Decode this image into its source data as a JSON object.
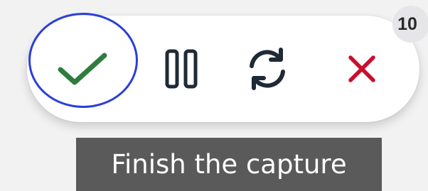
{
  "toolbar": {
    "finish_icon": "checkmark-icon",
    "pause_icon": "pause-icon",
    "restart_icon": "refresh-icon",
    "cancel_icon": "close-icon",
    "finish_color": "#2e7d3e",
    "control_color": "#1f2a36",
    "cancel_color": "#c8102e",
    "focus_ring_color": "#2b3fd8"
  },
  "badge": {
    "count": "10"
  },
  "tooltip": {
    "text": "Finish the capture"
  }
}
